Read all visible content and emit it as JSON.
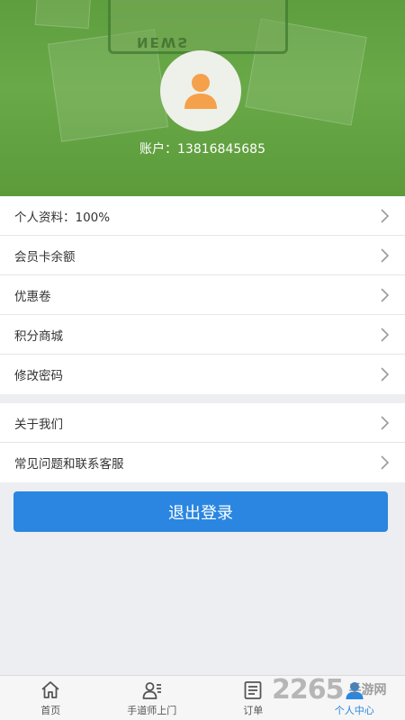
{
  "header": {
    "bg_color": "#66a545",
    "decoration_text": "NEWS",
    "account_label": "账户：",
    "account_number": "13816845685"
  },
  "menu": {
    "group1": [
      {
        "label": "个人资料：100%",
        "icon": "chevron-right-icon"
      },
      {
        "label": "会员卡余额",
        "icon": "chevron-right-icon"
      },
      {
        "label": "优惠卷",
        "icon": "chevron-right-icon"
      },
      {
        "label": "积分商城",
        "icon": "chevron-right-icon"
      },
      {
        "label": "修改密码",
        "icon": "chevron-right-icon"
      }
    ],
    "group2": [
      {
        "label": "关于我们",
        "icon": "chevron-right-icon"
      },
      {
        "label": "常见问题和联系客服",
        "icon": "chevron-right-icon"
      }
    ]
  },
  "logout": {
    "label": "退出登录",
    "color": "#2a86e0"
  },
  "tabbar": {
    "tabs": [
      {
        "label": "首页",
        "icon": "home-icon",
        "active": false
      },
      {
        "label": "手道师上门",
        "icon": "technician-icon",
        "active": false
      },
      {
        "label": "订单",
        "icon": "order-list-icon",
        "active": false
      },
      {
        "label": "个人中心",
        "icon": "user-icon",
        "active": true
      }
    ],
    "active_color": "#2a86e0"
  },
  "watermark": {
    "number": "2265",
    "text": "手游网"
  }
}
